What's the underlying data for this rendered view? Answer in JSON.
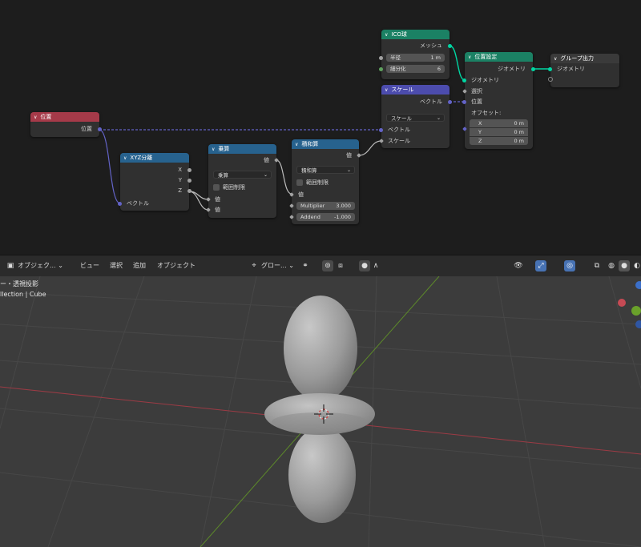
{
  "nodes": {
    "position": {
      "title": "位置",
      "out": "位置"
    },
    "xyz": {
      "title": "XYZ分離",
      "x": "X",
      "y": "Y",
      "z": "Z",
      "in": "ベクトル"
    },
    "multiply": {
      "title": "乗算",
      "out": "値",
      "op": "乗算",
      "clamp": "範囲制限",
      "in1": "値",
      "in2": "値"
    },
    "muladd": {
      "title": "積和算",
      "out": "値",
      "op": "積和算",
      "clamp": "範囲制限",
      "in": "値",
      "mult_label": "Multiplier",
      "mult_val": "3.000",
      "add_label": "Addend",
      "add_val": "-1.000"
    },
    "ico": {
      "title": "ICO球",
      "out": "メッシュ",
      "radius_label": "半径",
      "radius_val": "1 m",
      "sub_label": "細分化",
      "sub_val": "6"
    },
    "scale": {
      "title": "スケール",
      "out": "ベクトル",
      "op": "スケール",
      "in1": "ベクトル",
      "in2": "スケール"
    },
    "setpos": {
      "title": "位置設定",
      "out": "ジオメトリ",
      "geo": "ジオメトリ",
      "sel": "選択",
      "pos": "位置",
      "offset": "オフセット:",
      "x_label": "X",
      "x_val": "0 m",
      "y_label": "Y",
      "y_val": "0 m",
      "z_label": "Z",
      "z_val": "0 m"
    },
    "groupout": {
      "title": "グループ出力",
      "geo": "ジオメトリ"
    }
  },
  "viewport_header": {
    "mode": "オブジェク...",
    "view": "ビュー",
    "select": "選択",
    "add": "追加",
    "object": "オブジェクト",
    "orientation": "グロー..."
  },
  "viewport": {
    "title": "ー・透視投影",
    "collection": "llection | Cube"
  },
  "colors": {
    "geometry_socket": "#00d6a3",
    "vector_socket": "#6363c7",
    "float_socket": "#a1a1a1",
    "input_header": "#a53a49",
    "converter_header": "#27628e",
    "geometry_header": "#1b8164",
    "vector_header": "#4c4cad"
  }
}
